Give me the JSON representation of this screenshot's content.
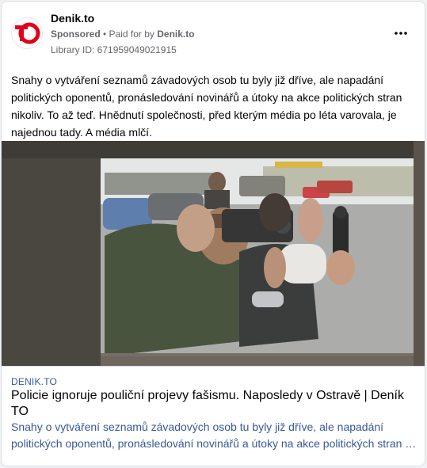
{
  "post": {
    "page_name": "Denik.to",
    "sponsored_label": "Sponsored",
    "separator": " • ",
    "paid_for_label": "Paid for by ",
    "paid_for_name": "Denik.to",
    "library_id": "Library ID: 671959049021915",
    "more_icon": "more-options-icon",
    "body_text": "Snahy o vytváření seznamů závadových osob tu byly již dříve, ale napadání politických oponentů, pronásledování novinářů a útoky na akce politických stran nikoliv. To až teď. Hnědnutí společnosti, před kterým média po léta varovala, je najednou tady. A média mlčí."
  },
  "link_preview": {
    "domain": "DENIK.TO",
    "headline": "Policie ignoruje pouliční projevy fašismu. Naposledy v Ostravě | Deník TO",
    "description_line1": "Snahy o vytváření seznamů závadových osob tu byly již dříve, ale napadání",
    "description_line2": "politických oponentů, pronásledování novinářů a útoky na akce politických stran …"
  },
  "colors": {
    "brand_red": "#e2001a",
    "link_blue": "#385898",
    "secondary_text": "#65676b"
  }
}
